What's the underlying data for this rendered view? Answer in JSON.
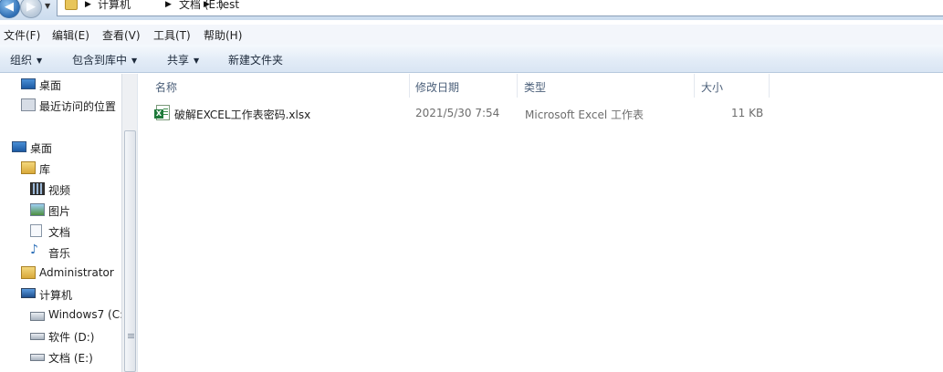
{
  "address_bar": {
    "crumbs": [
      "计算机",
      "文档 (E:)",
      "test"
    ]
  },
  "menu": {
    "items": [
      "文件(F)",
      "编辑(E)",
      "查看(V)",
      "工具(T)",
      "帮助(H)"
    ]
  },
  "toolbar": {
    "organize": "组织",
    "include_in_library": "包含到库中",
    "share": "共享",
    "new_folder": "新建文件夹"
  },
  "nav": {
    "favorites": [
      {
        "label": "桌面",
        "icon": "desktop-icon"
      },
      {
        "label": "最近访问的位置",
        "icon": "recent-places-icon"
      }
    ],
    "desktop": {
      "label": "桌面",
      "icon": "desktop-icon"
    },
    "libraries": {
      "label": "库",
      "icon": "library-folder-icon"
    },
    "library_items": [
      {
        "label": "视频",
        "icon": "video-icon"
      },
      {
        "label": "图片",
        "icon": "picture-icon"
      },
      {
        "label": "文档",
        "icon": "document-icon"
      },
      {
        "label": "音乐",
        "icon": "music-icon"
      }
    ],
    "user": {
      "label": "Administrator",
      "icon": "user-folder-icon"
    },
    "computer": {
      "label": "计算机",
      "icon": "computer-icon"
    },
    "drives": [
      {
        "label": "Windows7 (C:",
        "icon": "windows-drive-icon"
      },
      {
        "label": "软件 (D:)",
        "icon": "drive-icon"
      },
      {
        "label": "文档 (E:)",
        "icon": "drive-icon"
      }
    ]
  },
  "file_list": {
    "columns": {
      "name": "名称",
      "modified": "修改日期",
      "type": "类型",
      "size": "大小"
    },
    "rows": [
      {
        "name": "破解EXCEL工作表密码.xlsx",
        "modified": "2021/5/30 7:54",
        "type": "Microsoft Excel 工作表",
        "size": "11 KB",
        "icon": "excel-file-icon"
      }
    ]
  },
  "colors": {
    "toolbar_bg": "#e3ecf7",
    "header_text": "#4c607a",
    "excel_green": "#1f7a3a"
  }
}
